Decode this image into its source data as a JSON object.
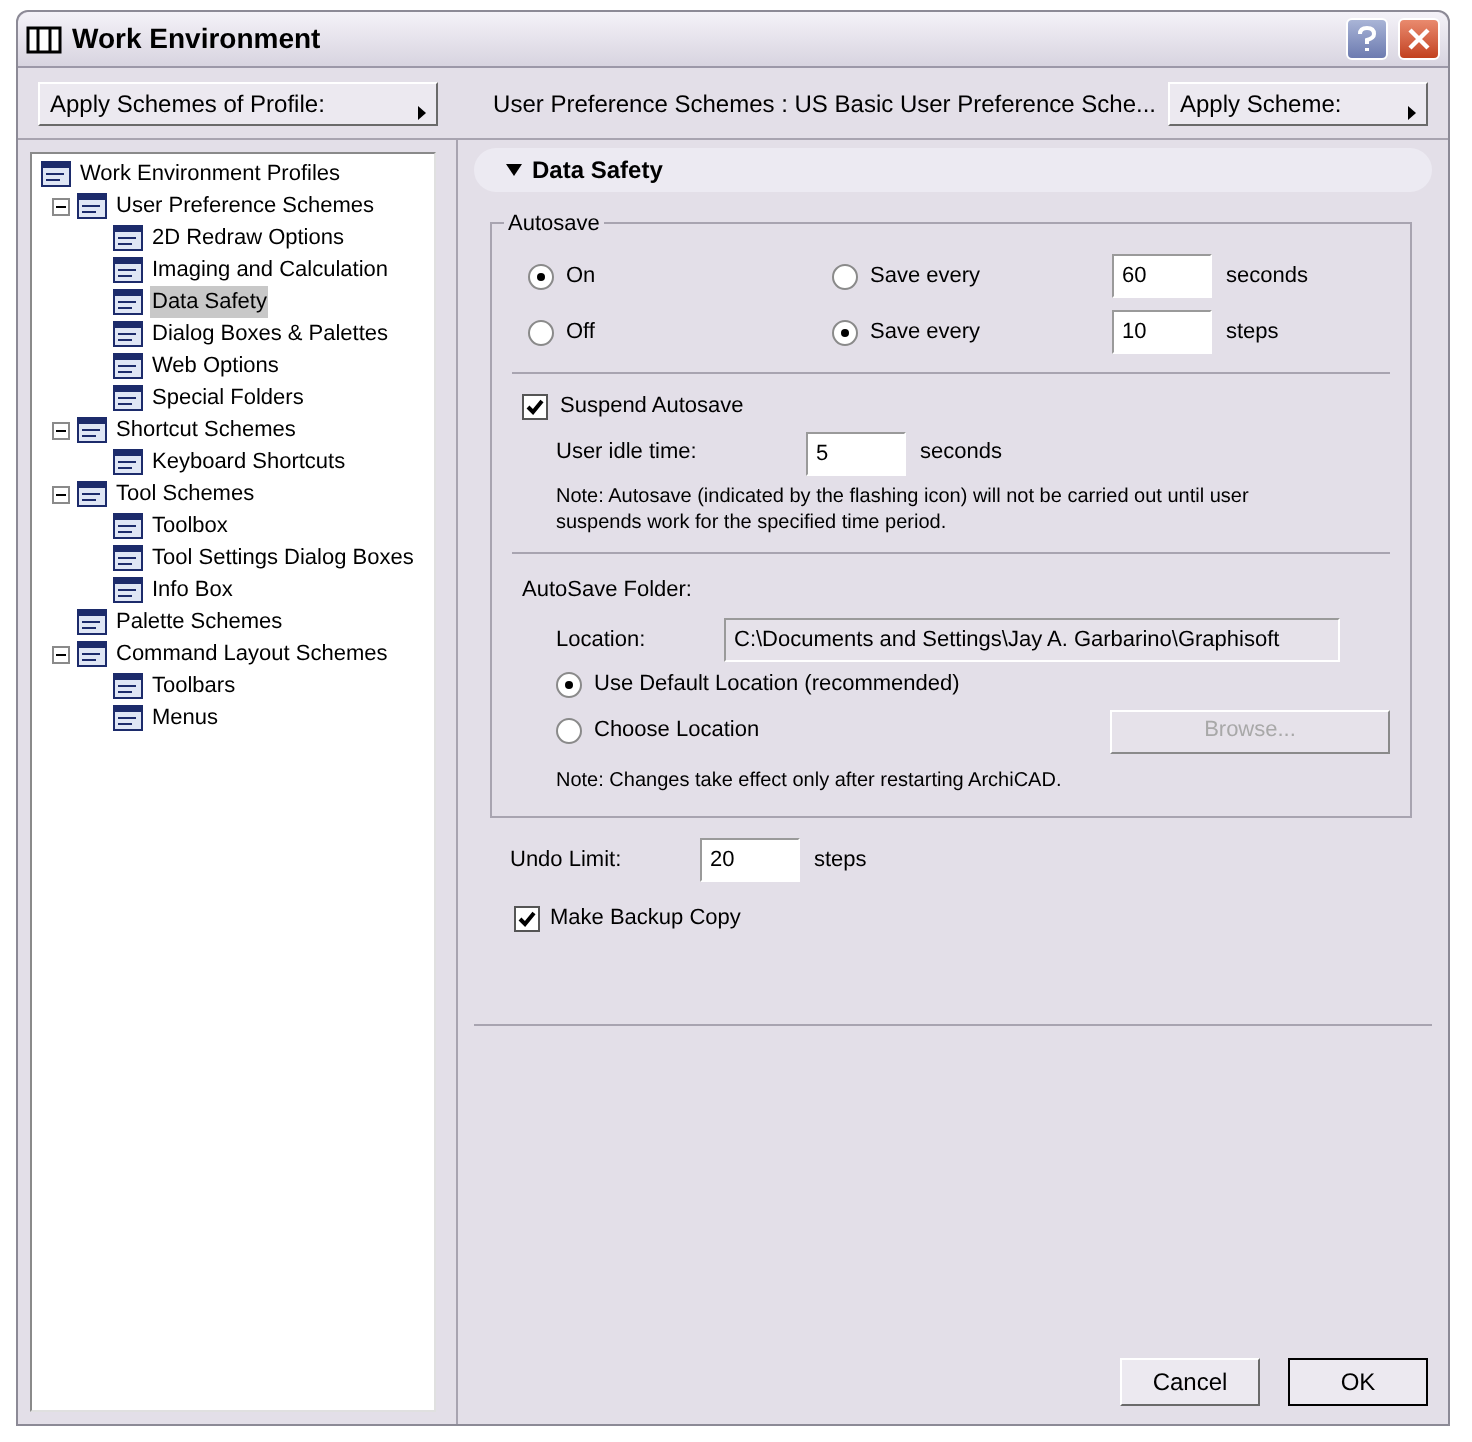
{
  "window": {
    "title": "Work Environment"
  },
  "toolbar": {
    "profile_button": "Apply Schemes of Profile:",
    "scheme_path": "User Preference Schemes : US Basic User Preference Sche...",
    "scheme_button": "Apply Scheme:"
  },
  "tree": [
    {
      "label": "Work Environment Profiles",
      "selected": false,
      "children": [
        {
          "label": "User Preference Schemes",
          "selected": false,
          "expanded": true,
          "children": [
            {
              "label": "2D Redraw Options",
              "selected": false
            },
            {
              "label": "Imaging and Calculation",
              "selected": false
            },
            {
              "label": "Data Safety",
              "selected": true
            },
            {
              "label": "Dialog Boxes & Palettes",
              "selected": false
            },
            {
              "label": "Web Options",
              "selected": false
            },
            {
              "label": "Special Folders",
              "selected": false
            }
          ]
        },
        {
          "label": "Shortcut Schemes",
          "selected": false,
          "expanded": true,
          "children": [
            {
              "label": "Keyboard Shortcuts",
              "selected": false
            }
          ]
        },
        {
          "label": "Tool Schemes",
          "selected": false,
          "expanded": true,
          "children": [
            {
              "label": "Toolbox",
              "selected": false
            },
            {
              "label": "Tool Settings Dialog Boxes",
              "selected": false
            },
            {
              "label": "Info Box",
              "selected": false
            }
          ]
        },
        {
          "label": "Palette Schemes",
          "selected": false
        },
        {
          "label": "Command Layout Schemes",
          "selected": false,
          "expanded": true,
          "children": [
            {
              "label": "Toolbars",
              "selected": false
            },
            {
              "label": "Menus",
              "selected": false
            }
          ]
        }
      ]
    }
  ],
  "panel": {
    "header": "Data Safety",
    "expanded": true,
    "autosave": {
      "title": "Autosave",
      "options": [
        {
          "label": "On",
          "selected": true
        },
        {
          "label": "Off",
          "selected": false
        }
      ],
      "intervals": [
        {
          "label": "Save every",
          "selected": false,
          "value": "60",
          "unit": "seconds"
        },
        {
          "label": "Save every",
          "selected": true,
          "value": "10",
          "unit": "steps"
        }
      ],
      "suspend": {
        "label": "Suspend Autosave",
        "checked": true
      },
      "idle": {
        "label": "User idle time:",
        "value": "5",
        "unit": "seconds"
      },
      "note": "Note: Autosave (indicated by the flashing icon) will not be carried out until user suspends work for the specified time period.",
      "folder": {
        "title": "AutoSave Folder:",
        "location_label": "Location:",
        "location_value": "C:\\Documents and Settings\\Jay A. Garbarino\\Graphisoft",
        "choices": [
          {
            "label": "Use Default Location (recommended)",
            "selected": true
          },
          {
            "label": "Choose Location",
            "selected": false
          }
        ],
        "browse": {
          "label": "Browse...",
          "disabled": true
        },
        "note": "Note: Changes take effect only after restarting ArchiCAD."
      }
    },
    "undo": {
      "label": "Undo Limit:",
      "value": "20",
      "unit": "steps"
    },
    "backup": {
      "label": "Make Backup Copy",
      "checked": true
    }
  },
  "buttons": [
    {
      "label": "Cancel",
      "default": false
    },
    {
      "label": "OK",
      "default": true
    }
  ]
}
